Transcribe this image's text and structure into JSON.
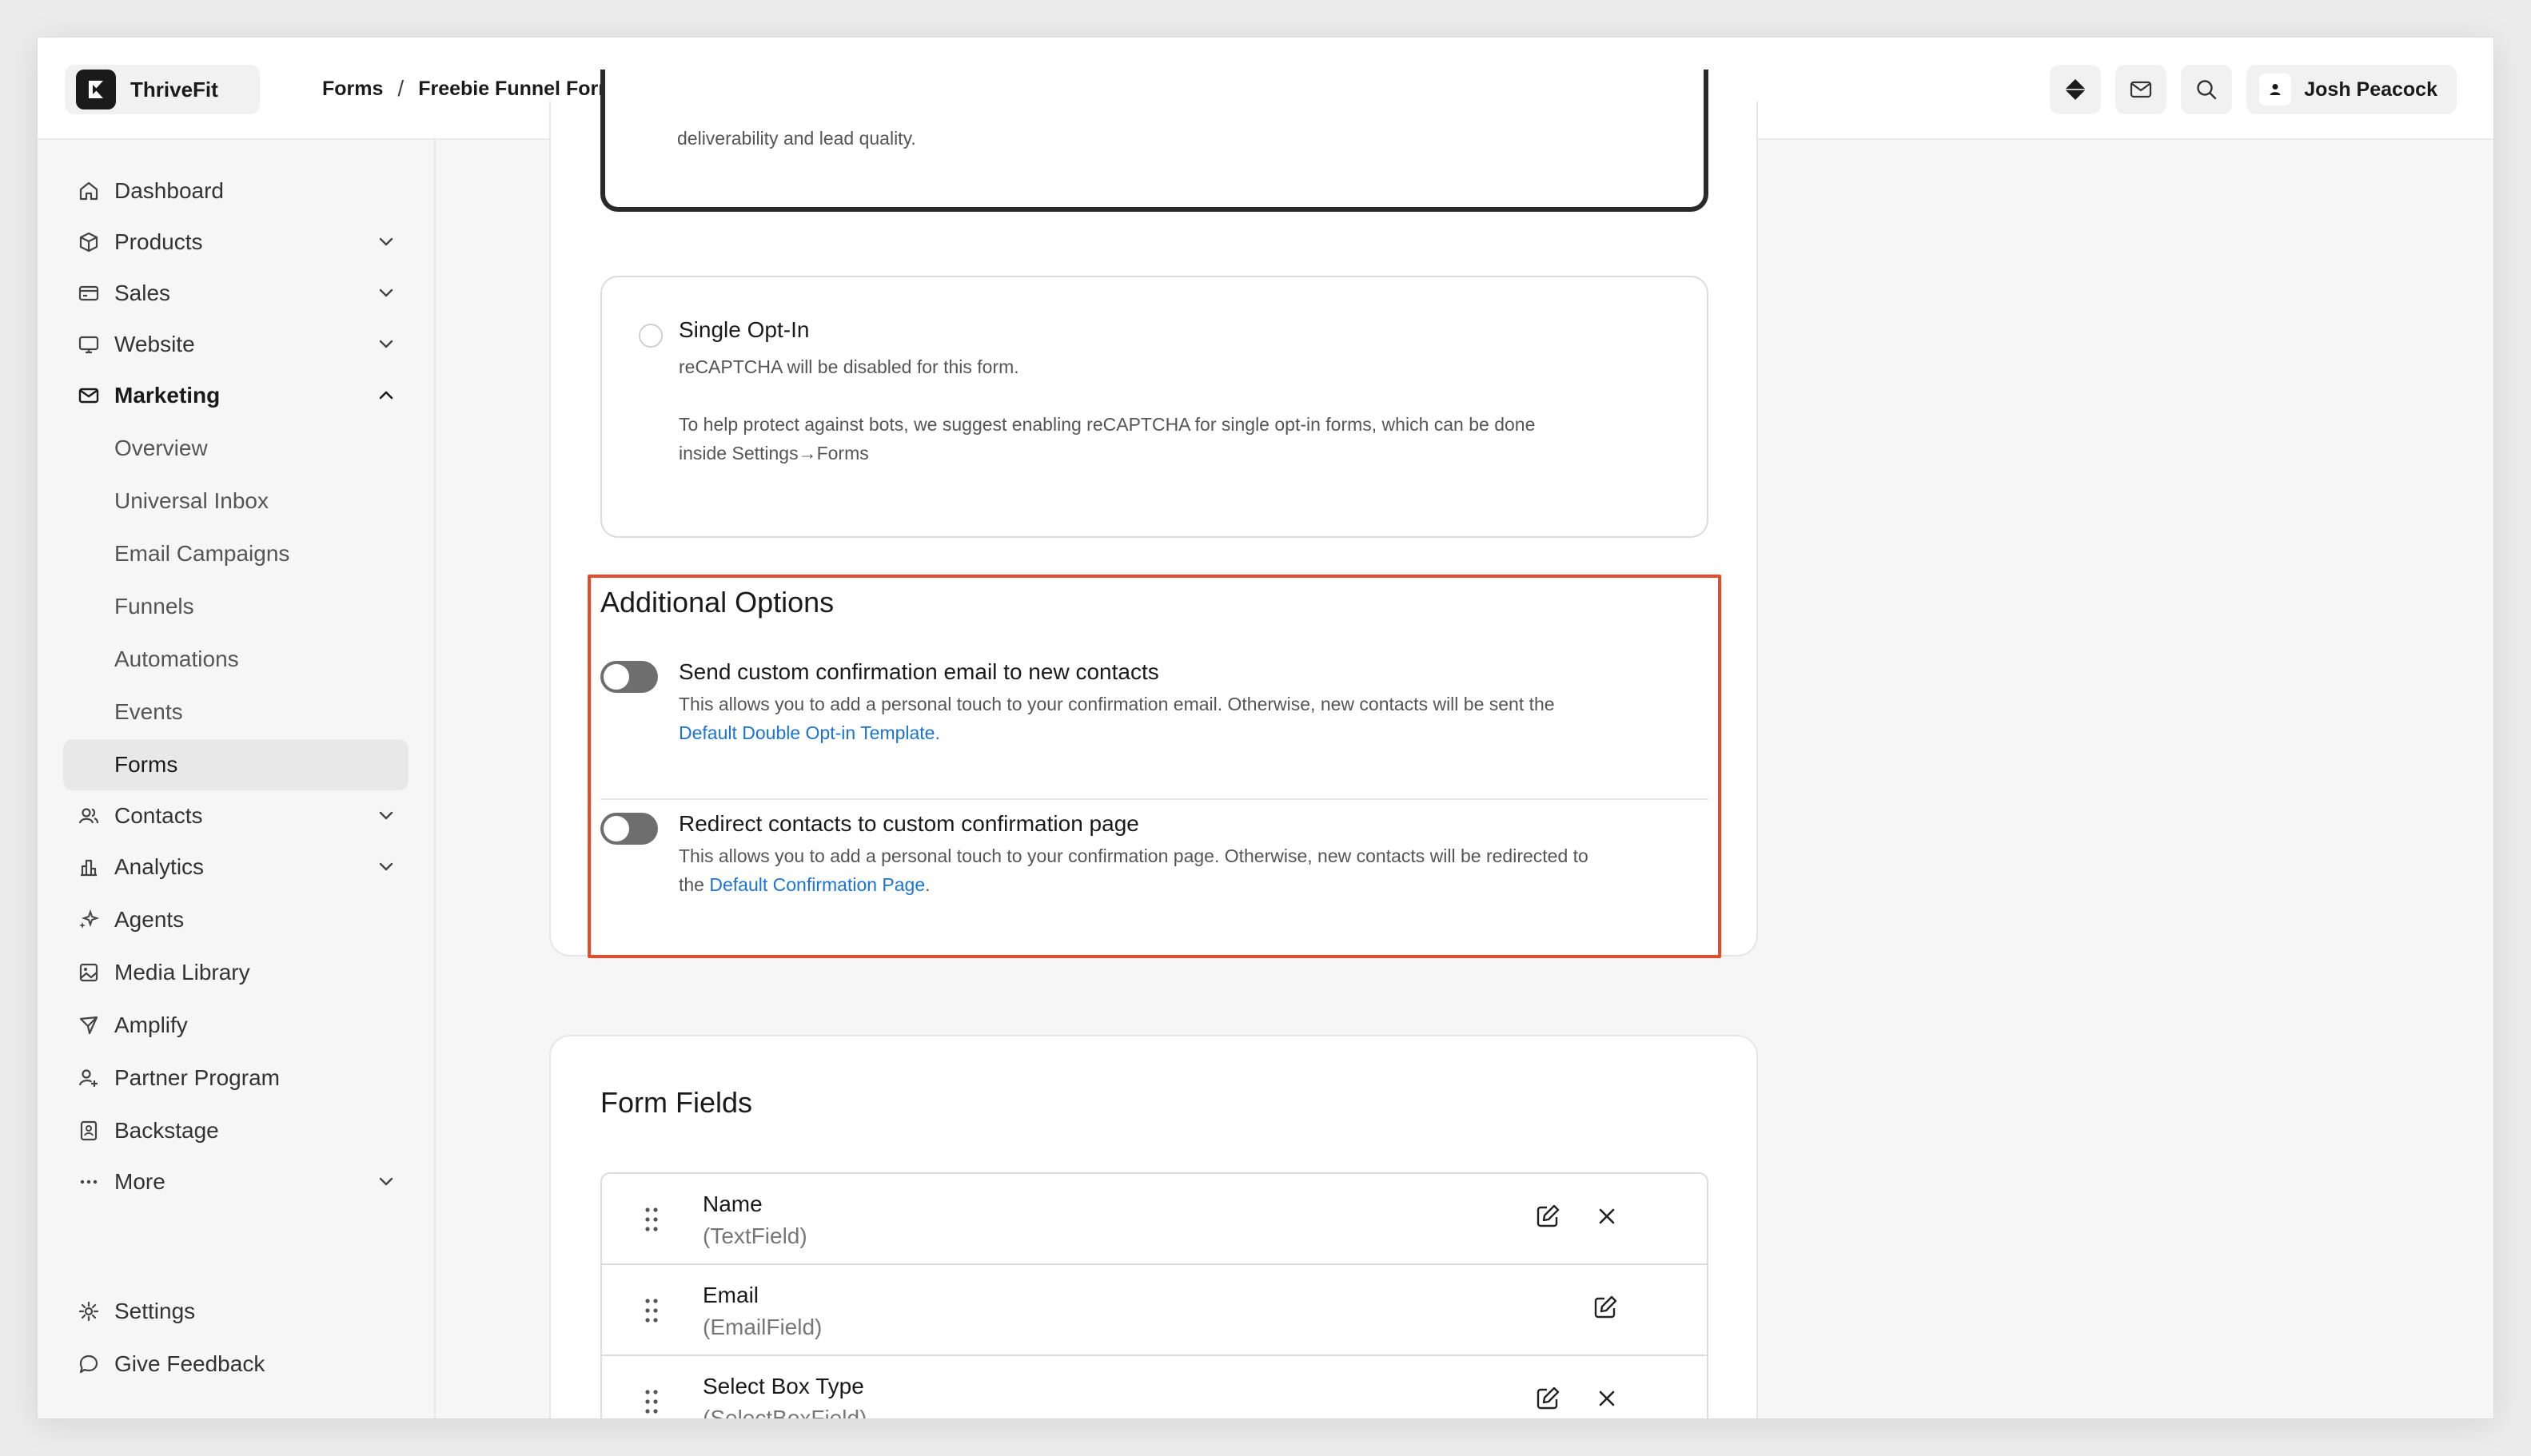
{
  "header": {
    "brand_name": "ThriveFit",
    "breadcrumb": [
      "Forms",
      "Freebie Funnel Form"
    ],
    "breadcrumb_separator": "/",
    "user_name": "Josh Peacock",
    "icons": [
      "diamond-icon",
      "mail-icon",
      "search-icon",
      "user-icon"
    ]
  },
  "sidebar": {
    "items": [
      {
        "label": "Dashboard",
        "icon": "home-icon"
      },
      {
        "label": "Products",
        "icon": "box-icon"
      },
      {
        "label": "Sales",
        "icon": "card-icon"
      },
      {
        "label": "Website",
        "icon": "monitor-icon"
      },
      {
        "label": "Marketing",
        "icon": "mail-icon"
      },
      {
        "label": "Overview"
      },
      {
        "label": "Universal Inbox"
      },
      {
        "label": "Email Campaigns"
      },
      {
        "label": "Funnels"
      },
      {
        "label": "Automations"
      },
      {
        "label": "Events"
      },
      {
        "label": "Forms"
      },
      {
        "label": "Contacts",
        "icon": "users-icon"
      },
      {
        "label": "Analytics",
        "icon": "chart-icon"
      },
      {
        "label": "Agents",
        "icon": "sparkle-icon"
      },
      {
        "label": "Media Library",
        "icon": "image-icon"
      },
      {
        "label": "Amplify",
        "icon": "send-icon"
      },
      {
        "label": "Partner Program",
        "icon": "user-plus-icon"
      },
      {
        "label": "Backstage",
        "icon": "badge-icon"
      },
      {
        "label": "More",
        "icon": "dots-icon"
      }
    ],
    "footer": [
      {
        "label": "Settings",
        "icon": "gear-icon"
      },
      {
        "label": "Give Feedback",
        "icon": "chat-icon"
      }
    ]
  },
  "optin": {
    "double_text": "deliverability and lead quality.",
    "single_title": "Single Opt-In",
    "single_line1": "reCAPTCHA will be disabled for this form.",
    "single_line2": "To help protect against bots, we suggest enabling reCAPTCHA for single opt-in forms, which can be done",
    "single_line3": "inside Settings→Forms"
  },
  "additional": {
    "title": "Additional Options",
    "opt1_title": "Send custom confirmation email to new contacts",
    "opt1_desc": "This allows you to add a personal touch to your confirmation email. Otherwise, new contacts will be sent the",
    "opt1_link": "Default Double Opt-in Template",
    "opt1_after": ".",
    "opt2_title": "Redirect contacts to custom confirmation page",
    "opt2_desc": "This allows you to add a personal touch to your confirmation page. Otherwise, new contacts will be redirected to",
    "opt2_before": "the ",
    "opt2_link": "Default Confirmation Page",
    "opt2_after": "."
  },
  "form_fields": {
    "title": "Form Fields",
    "rows": [
      {
        "name": "Name",
        "type": "(TextField)",
        "removable": true
      },
      {
        "name": "Email",
        "type": "(EmailField)",
        "removable": false
      },
      {
        "name": "Select Box Type",
        "type": "(SelectBoxField)",
        "removable": true
      }
    ]
  },
  "colors": {
    "highlight": "#e8492a",
    "link": "#1a73d9"
  }
}
